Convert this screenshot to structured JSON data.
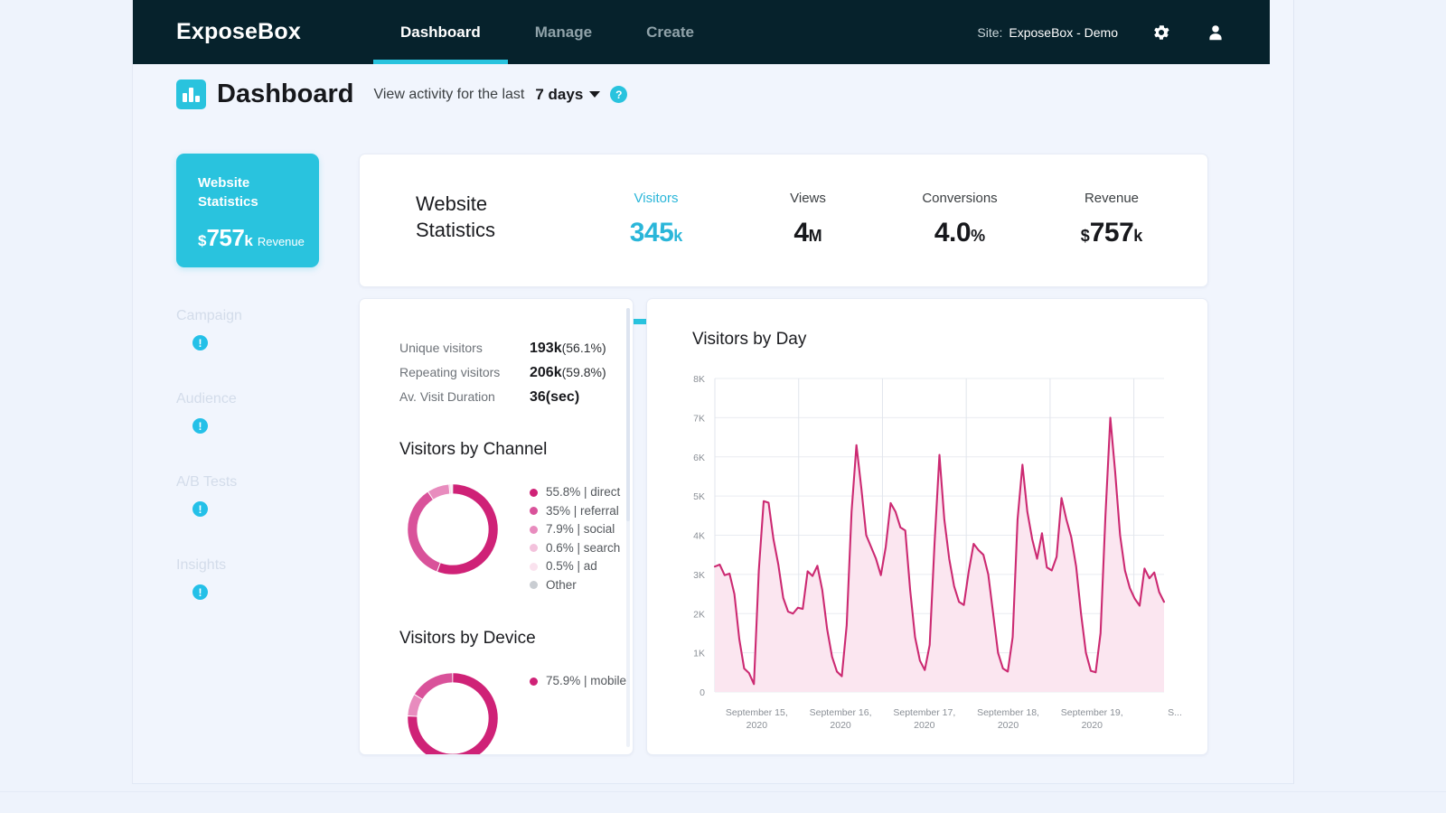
{
  "nav": {
    "brand": "ExposeBox",
    "links": [
      {
        "label": "Dashboard",
        "active": true
      },
      {
        "label": "Manage",
        "active": false
      },
      {
        "label": "Create",
        "active": false
      }
    ],
    "site_label": "Site:",
    "site_value": "ExposeBox - Demo",
    "settings_icon": "gear-icon",
    "account_icon": "user-icon"
  },
  "header": {
    "logo_icon": "bar-chart-icon",
    "title": "Dashboard",
    "activity_label": "View activity for the last",
    "range_value": "7 days",
    "help_badge": "?"
  },
  "rail": {
    "hero": {
      "title_line1": "Website",
      "title_line2": "Statistics",
      "currency": "$",
      "number": "757",
      "suffix": "k",
      "caption": "Revenue"
    },
    "items": [
      {
        "label": "Campaign",
        "badge": "!"
      },
      {
        "label": "Audience",
        "badge": "!"
      },
      {
        "label": "A/B Tests",
        "badge": "!"
      },
      {
        "label": "Insights",
        "badge": "!"
      }
    ]
  },
  "kpi": {
    "heading_line1": "Website",
    "heading_line2": "Statistics",
    "items": [
      {
        "label": "Visitors",
        "value": "345",
        "unit": "k",
        "prefix": "",
        "active": true
      },
      {
        "label": "Views",
        "value": "4",
        "unit": "M",
        "prefix": "",
        "active": false
      },
      {
        "label": "Conversions",
        "value": "4.0",
        "unit": "%",
        "prefix": "",
        "active": false
      },
      {
        "label": "Revenue",
        "value": "757",
        "unit": "k",
        "prefix": "$",
        "active": false
      }
    ]
  },
  "stats": [
    {
      "name": "Unique visitors",
      "value": "193k",
      "detail": "(56.1%)"
    },
    {
      "name": "Repeating visitors",
      "value": "206k",
      "detail": "(59.8%)"
    },
    {
      "name": "Av. Visit Duration",
      "value": "36(sec)",
      "detail": ""
    }
  ],
  "channel": {
    "title": "Visitors by Channel",
    "legend": [
      {
        "label": "55.8% | direct",
        "color": "#cf2277",
        "value": 55.8
      },
      {
        "label": "35% | referral",
        "color": "#d9529a",
        "value": 35
      },
      {
        "label": "7.9% | social",
        "color": "#e88cbe",
        "value": 7.9
      },
      {
        "label": "0.6% | search",
        "color": "#f3c2dc",
        "value": 0.6
      },
      {
        "label": "0.5% | ad",
        "color": "#fae2ee",
        "value": 0.5
      },
      {
        "label": "Other",
        "color": "#c9cdd2",
        "value": 0.2
      }
    ]
  },
  "device": {
    "title": "Visitors by Device",
    "legend": [
      {
        "label": "75.9% | mobile",
        "color": "#cf2277",
        "value": 75.9
      },
      {
        "label": "",
        "color": "#e88cbe",
        "value": 8
      },
      {
        "label": "",
        "color": "#d9529a",
        "value": 16.1
      }
    ]
  },
  "chart_data": {
    "type": "area",
    "title": "Visitors by Day",
    "xlabel": "",
    "ylabel": "",
    "ylim": [
      0,
      8000
    ],
    "ytick_labels": [
      "0",
      "1K",
      "2K",
      "3K",
      "4K",
      "5K",
      "6K",
      "7K",
      "8K"
    ],
    "ytick_values": [
      0,
      1000,
      2000,
      3000,
      4000,
      5000,
      6000,
      7000,
      8000
    ],
    "grid": true,
    "legend_position": "none",
    "line_color": "#cc2a72",
    "fill_color": "#fbe6f0",
    "xtick_labels": [
      "September 15,\n2020",
      "September 16,\n2020",
      "September 17,\n2020",
      "September 18,\n2020",
      "September 19,\n2020",
      "S..."
    ],
    "series": [
      {
        "name": "Visitors",
        "values": [
          3200,
          3250,
          2980,
          3020,
          2500,
          1350,
          600,
          480,
          200,
          3100,
          4870,
          4830,
          3900,
          3250,
          2400,
          2050,
          2000,
          2150,
          2120,
          3080,
          2960,
          3220,
          2600,
          1600,
          900,
          520,
          400,
          1700,
          4600,
          6300,
          5200,
          4000,
          3700,
          3400,
          2980,
          3700,
          4820,
          4600,
          4200,
          4120,
          2600,
          1400,
          800,
          560,
          1200,
          3800,
          6050,
          4400,
          3400,
          2700,
          2300,
          2220,
          3080,
          3780,
          3620,
          3500,
          3000,
          2000,
          1000,
          600,
          520,
          1400,
          4400,
          5800,
          4600,
          3900,
          3400,
          4050,
          3180,
          3100,
          3450,
          4950,
          4400,
          3950,
          3200,
          2000,
          1000,
          540,
          500,
          1500,
          4500,
          7000,
          5600,
          4000,
          3100,
          2650,
          2380,
          2200,
          3150,
          2900,
          3050,
          2550,
          2300
        ]
      }
    ]
  }
}
